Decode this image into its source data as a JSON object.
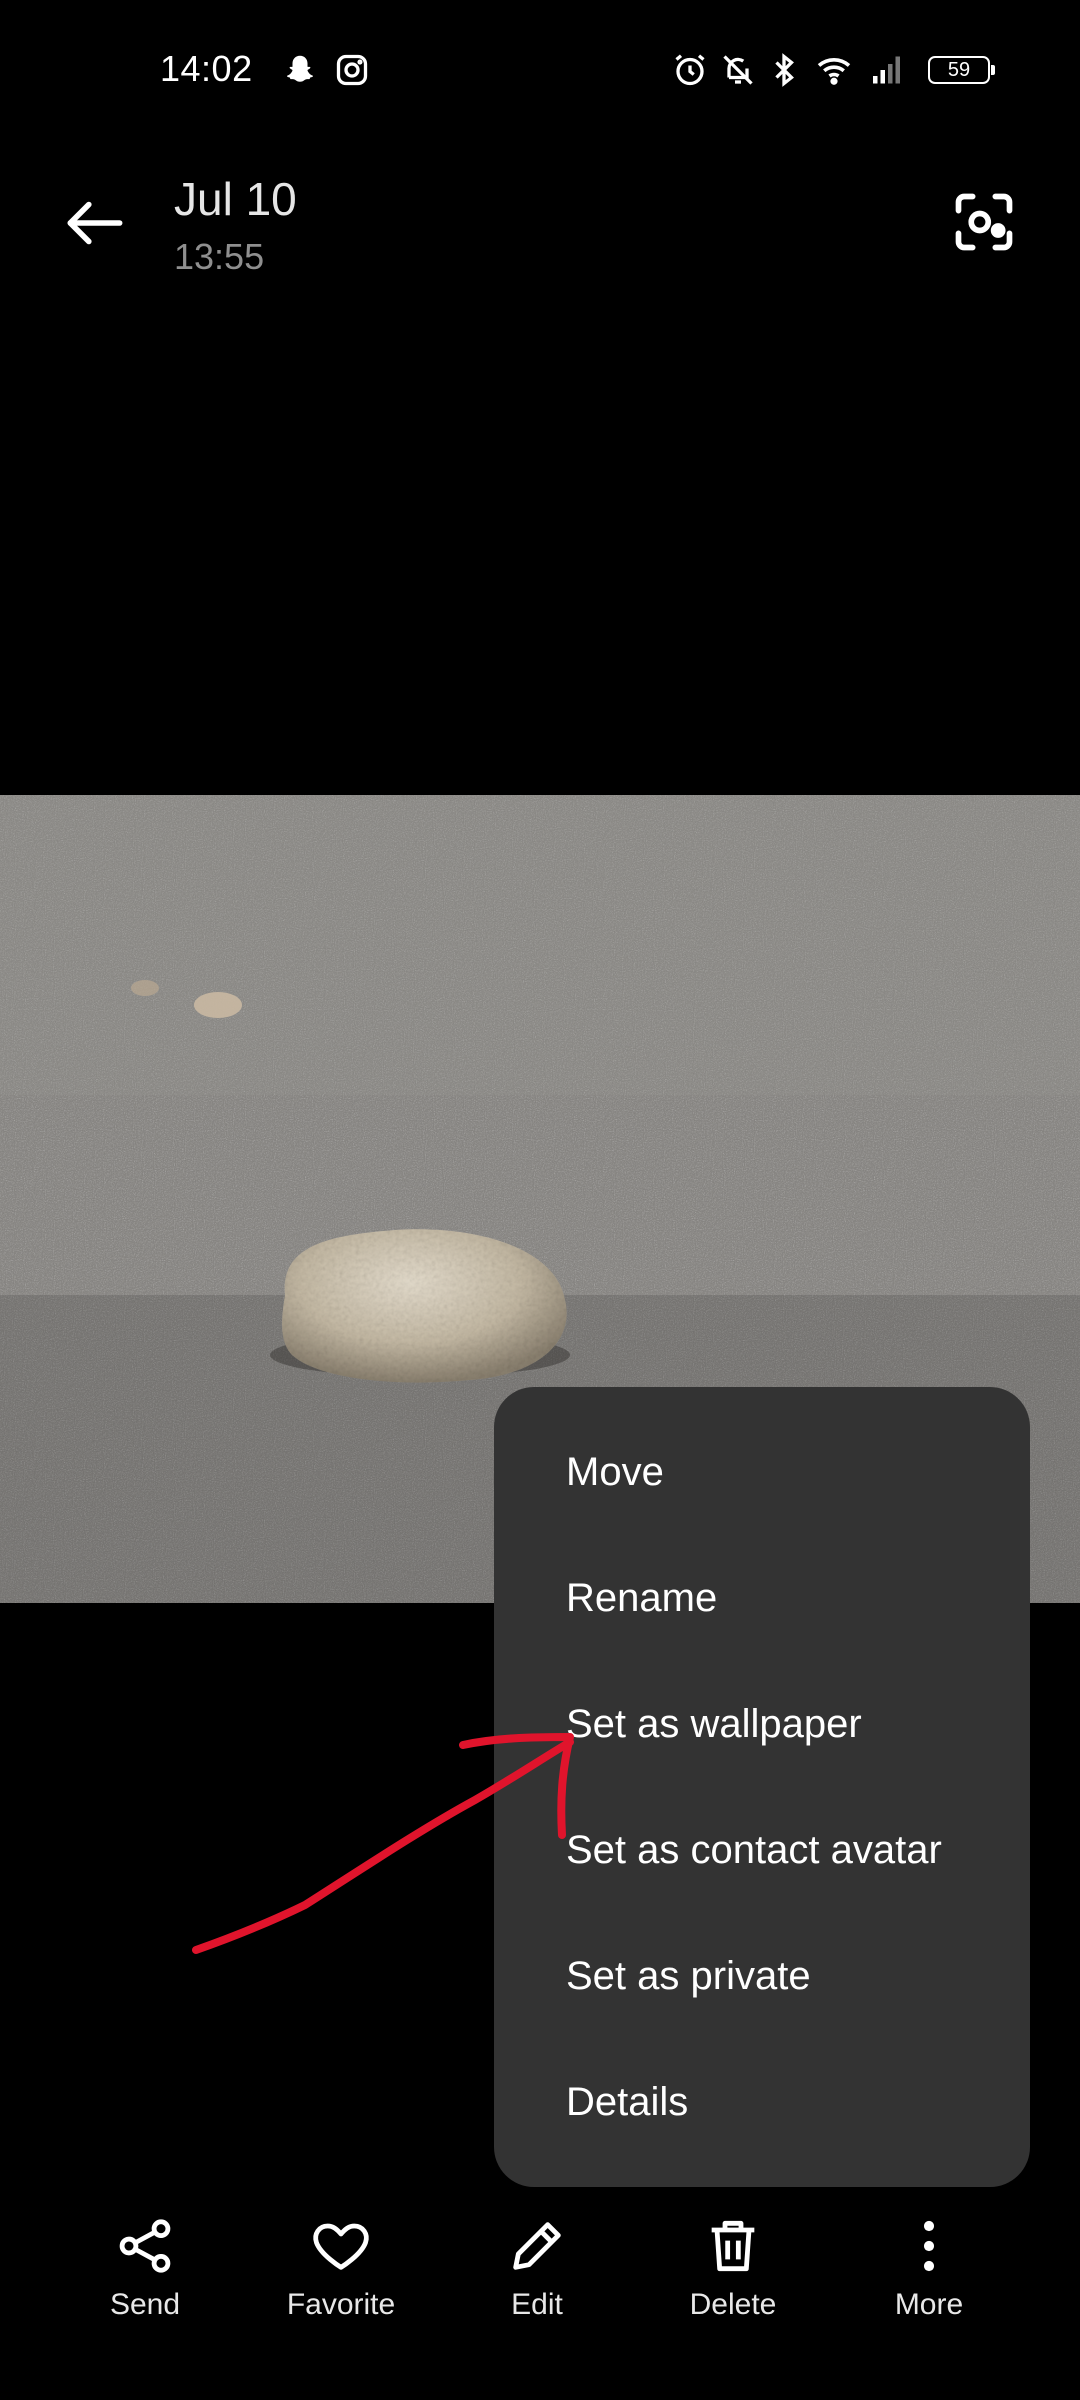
{
  "status_bar": {
    "time": "14:02",
    "battery": "59",
    "icons": [
      "snapchat-icon",
      "instagram-icon",
      "alarm-icon",
      "mute-icon",
      "bluetooth-icon",
      "wifi-icon",
      "signal-icon"
    ]
  },
  "header": {
    "date": "Jul 10",
    "time": "13:55",
    "back_icon": "back-arrow-icon",
    "lens_icon": "lens-scan-icon"
  },
  "menu": {
    "items": [
      "Move",
      "Rename",
      "Set as wallpaper",
      "Set as contact avatar",
      "Set as private",
      "Details"
    ]
  },
  "annotation": {
    "color": "#e0142c"
  },
  "toolbar": {
    "items": [
      {
        "label": "Send",
        "icon": "share-icon"
      },
      {
        "label": "Favorite",
        "icon": "heart-icon"
      },
      {
        "label": "Edit",
        "icon": "pencil-icon"
      },
      {
        "label": "Delete",
        "icon": "trash-icon"
      },
      {
        "label": "More",
        "icon": "more-vertical-icon"
      }
    ]
  }
}
